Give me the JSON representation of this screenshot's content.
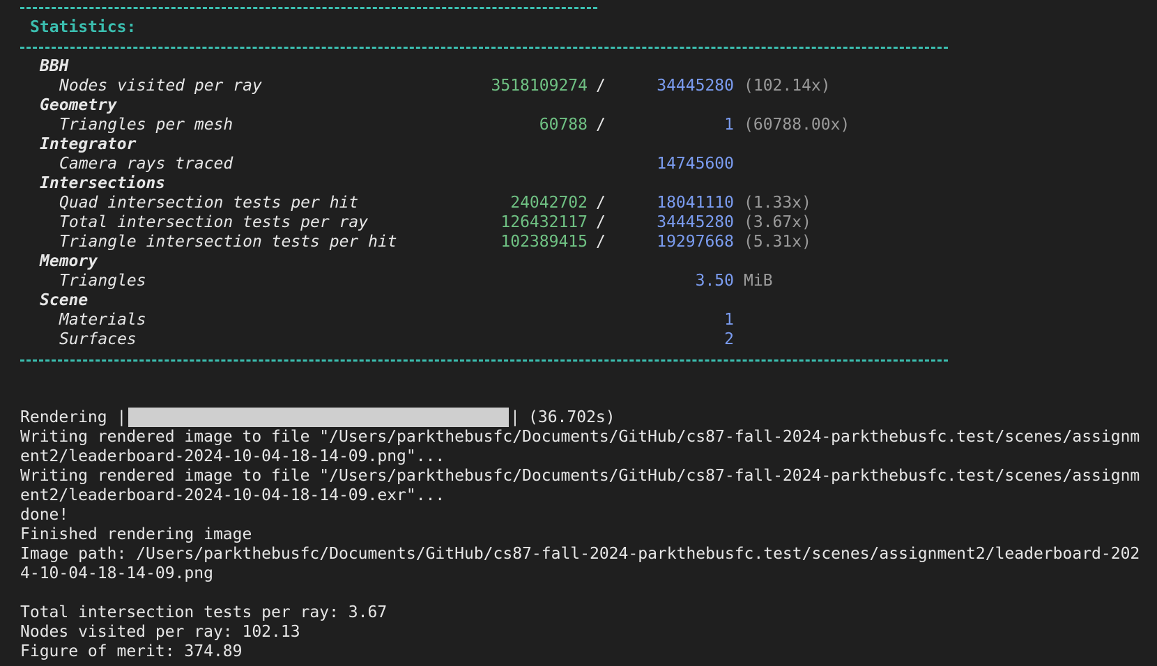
{
  "statistics": {
    "title": "Statistics:",
    "sections": [
      {
        "name": "BBH",
        "rows": [
          {
            "label": "Nodes visited per ray",
            "numerator": "3518109274",
            "slash": "/",
            "denominator": "34445280",
            "ratio": "(102.14x)"
          }
        ]
      },
      {
        "name": "Geometry",
        "rows": [
          {
            "label": "Triangles per mesh",
            "numerator": "60788",
            "slash": "/",
            "denominator": "1",
            "ratio": "(60788.00x)"
          }
        ]
      },
      {
        "name": "Integrator",
        "rows": [
          {
            "label": "Camera rays traced",
            "numerator": "",
            "slash": "",
            "denominator": "14745600",
            "ratio": ""
          }
        ]
      },
      {
        "name": "Intersections",
        "rows": [
          {
            "label": "Quad intersection tests per hit",
            "numerator": "24042702",
            "slash": "/",
            "denominator": "18041110",
            "ratio": "(1.33x)"
          },
          {
            "label": "Total intersection tests per ray",
            "numerator": "126432117",
            "slash": "/",
            "denominator": "34445280",
            "ratio": "(3.67x)"
          },
          {
            "label": "Triangle intersection tests per hit",
            "numerator": "102389415",
            "slash": "/",
            "denominator": "19297668",
            "ratio": "(5.31x)"
          }
        ]
      },
      {
        "name": "Memory",
        "rows": [
          {
            "label": "Triangles",
            "numerator": "",
            "slash": "",
            "denominator": "3.50",
            "ratio": "MiB"
          }
        ]
      },
      {
        "name": "Scene",
        "rows": [
          {
            "label": "Materials",
            "numerator": "",
            "slash": "",
            "denominator": "1",
            "ratio": ""
          },
          {
            "label": "Surfaces",
            "numerator": "",
            "slash": "",
            "denominator": "2",
            "ratio": ""
          }
        ]
      }
    ]
  },
  "rendering": {
    "label": "Rendering |",
    "bar_end": "|",
    "time": "(36.702s)",
    "progress_percent": 100
  },
  "output_lines": [
    "Writing rendered image to file \"/Users/parkthebusfc/Documents/GitHub/cs87-fall-2024-parkthebusfc.test/scenes/assignm",
    "ent2/leaderboard-2024-10-04-18-14-09.png\"...",
    "Writing rendered image to file \"/Users/parkthebusfc/Documents/GitHub/cs87-fall-2024-parkthebusfc.test/scenes/assignm",
    "ent2/leaderboard-2024-10-04-18-14-09.exr\"...",
    "done!",
    "Finished rendering image",
    "Image path: /Users/parkthebusfc/Documents/GitHub/cs87-fall-2024-parkthebusfc.test/scenes/assignment2/leaderboard-202",
    "4-10-04-18-14-09.png",
    "",
    "Total intersection tests per ray: 3.67",
    "Nodes visited per ray: 102.13",
    "Figure of merit: 374.89"
  ],
  "colors": {
    "background": "#1f1f1f",
    "rule": "#3bbfb0",
    "numerator": "#6fc183",
    "denominator": "#7b9cf0",
    "ratio": "#9a9a9a"
  }
}
